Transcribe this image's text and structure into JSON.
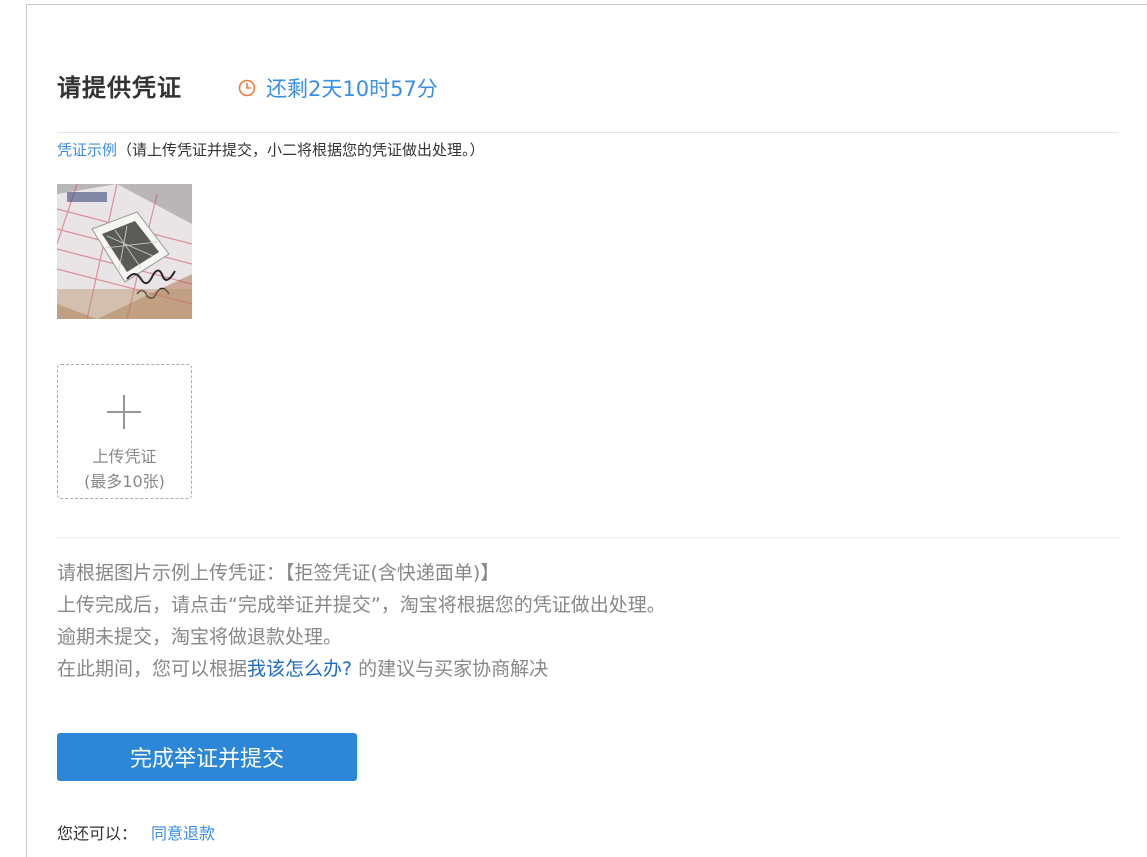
{
  "header": {
    "title": "请提供凭证",
    "countdown": "还剩2天10时57分",
    "clock_icon": "clock-icon",
    "accent_color": "#3a8ee6",
    "icon_color": "#f07c3a"
  },
  "example": {
    "link_label": "凭证示例",
    "note": "（请上传凭证并提交，小二将根据您的凭证做出处理。）"
  },
  "upload": {
    "icon": "plus-icon",
    "label": "上传凭证",
    "limit": "(最多10张)"
  },
  "info": {
    "line1": "请根据图片示例上传凭证：【拒签凭证(含快递面单)】",
    "line2": "上传完成后，请点击“完成举证并提交”，淘宝将根据您的凭证做出处理。",
    "line3": "逾期未提交，淘宝将做退款处理。",
    "line4_prefix": "在此期间，您可以根据",
    "line4_link": "我该怎么办?",
    "line4_suffix": " 的建议与买家协商解决"
  },
  "actions": {
    "submit_label": "完成举证并提交",
    "submit_color": "#2c87d8",
    "alt_prefix": "您还可以：",
    "alt_link": "同意退款"
  }
}
